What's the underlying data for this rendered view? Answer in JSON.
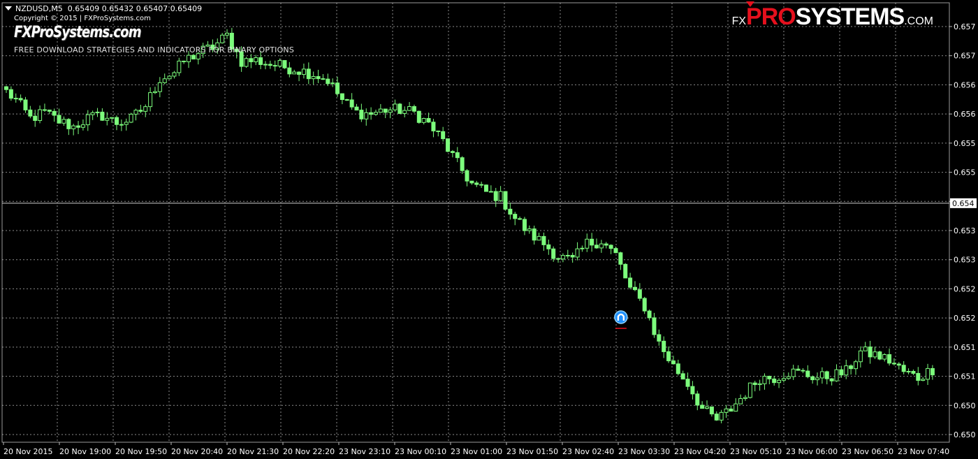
{
  "header": {
    "symbol": "NZDUSD,M5",
    "ohlc": "0.65409 0.65432 0.65407 0.65409",
    "copyright": "Copyright © 2015 | FXProSystems.com",
    "site_name": "FXProSystems.com",
    "tagline": "FREE DOWNLOAD STRATEGIES AND INDICATORS FOR BINARY OPTIONS"
  },
  "logo": {
    "fx": "FX",
    "pro": "PRO",
    "systems": "SYSTEMS",
    "com": ".COM"
  },
  "colors": {
    "background": "#000000",
    "grid": "#c8c8c8",
    "candle": "#7cfc7c",
    "axis_text": "#ffffff",
    "signal_icon": "#1e90ff",
    "signal_line": "#e5101d",
    "logo_red": "#e5101d"
  },
  "chart_data": {
    "type": "candlestick",
    "symbol": "NZDUSD",
    "timeframe": "M5",
    "current_price": "0.654",
    "y_ticks": [
      "0.657",
      "0.657",
      "0.656",
      "0.656",
      "0.655",
      "0.655",
      "0.654",
      "0.653",
      "0.653",
      "0.652",
      "0.652",
      "0.651",
      "0.651",
      "0.650",
      "0.650"
    ],
    "ylim": [
      0.64995,
      0.65711
    ],
    "x_labels": [
      "20 Nov 2015",
      "20 Nov 19:00",
      "20 Nov 19:50",
      "20 Nov 20:40",
      "20 Nov 21:30",
      "20 Nov 22:20",
      "23 Nov 23:10",
      "23 Nov 00:10",
      "23 Nov 01:00",
      "23 Nov 01:50",
      "23 Nov 02:40",
      "23 Nov 03:30",
      "23 Nov 04:20",
      "23 Nov 05:10",
      "23 Nov 06:00",
      "23 Nov 06:50",
      "23 Nov 07:40"
    ],
    "grid": true,
    "waypoints": [
      [
        0,
        0.65597
      ],
      [
        2,
        0.65582
      ],
      [
        5,
        0.6555
      ],
      [
        8,
        0.6556
      ],
      [
        11,
        0.65545
      ],
      [
        14,
        0.65535
      ],
      [
        17,
        0.6555
      ],
      [
        20,
        0.65555
      ],
      [
        23,
        0.65542
      ],
      [
        26,
        0.65548
      ],
      [
        29,
        0.65572
      ],
      [
        32,
        0.6562
      ],
      [
        35,
        0.6563
      ],
      [
        37,
        0.6565
      ],
      [
        40,
        0.65665
      ],
      [
        43,
        0.65675
      ],
      [
        46,
        0.65695
      ],
      [
        49,
        0.6565
      ],
      [
        52,
        0.65652
      ],
      [
        55,
        0.65645
      ],
      [
        58,
        0.6564
      ],
      [
        61,
        0.65635
      ],
      [
        64,
        0.65628
      ],
      [
        67,
        0.65617
      ],
      [
        70,
        0.65582
      ],
      [
        73,
        0.6556
      ],
      [
        76,
        0.65558
      ],
      [
        79,
        0.65565
      ],
      [
        82,
        0.65565
      ],
      [
        85,
        0.6556
      ],
      [
        88,
        0.6554
      ],
      [
        91,
        0.6551
      ],
      [
        94,
        0.6547
      ],
      [
        97,
        0.65435
      ],
      [
        100,
        0.6542
      ],
      [
        103,
        0.65412
      ],
      [
        106,
        0.65375
      ],
      [
        109,
        0.65348
      ],
      [
        112,
        0.6533
      ],
      [
        115,
        0.65307
      ],
      [
        118,
        0.653
      ],
      [
        121,
        0.6533
      ],
      [
        124,
        0.65335
      ],
      [
        127,
        0.6531
      ],
      [
        130,
        0.6525
      ],
      [
        133,
        0.6522
      ],
      [
        136,
        0.65155
      ],
      [
        139,
        0.65115
      ],
      [
        142,
        0.65085
      ],
      [
        145,
        0.6504
      ],
      [
        148,
        0.6502
      ],
      [
        151,
        0.6504
      ],
      [
        154,
        0.65068
      ],
      [
        157,
        0.65095
      ],
      [
        160,
        0.65095
      ],
      [
        163,
        0.65105
      ],
      [
        166,
        0.65102
      ],
      [
        169,
        0.65095
      ],
      [
        172,
        0.65098
      ],
      [
        175,
        0.65105
      ],
      [
        178,
        0.6514
      ],
      [
        181,
        0.65135
      ],
      [
        184,
        0.65125
      ],
      [
        187,
        0.65105
      ],
      [
        190,
        0.65095
      ],
      [
        193,
        0.6511
      ]
    ],
    "signal": {
      "type": "buy-arrow",
      "bar_index": 128,
      "price": 0.65201
    }
  }
}
